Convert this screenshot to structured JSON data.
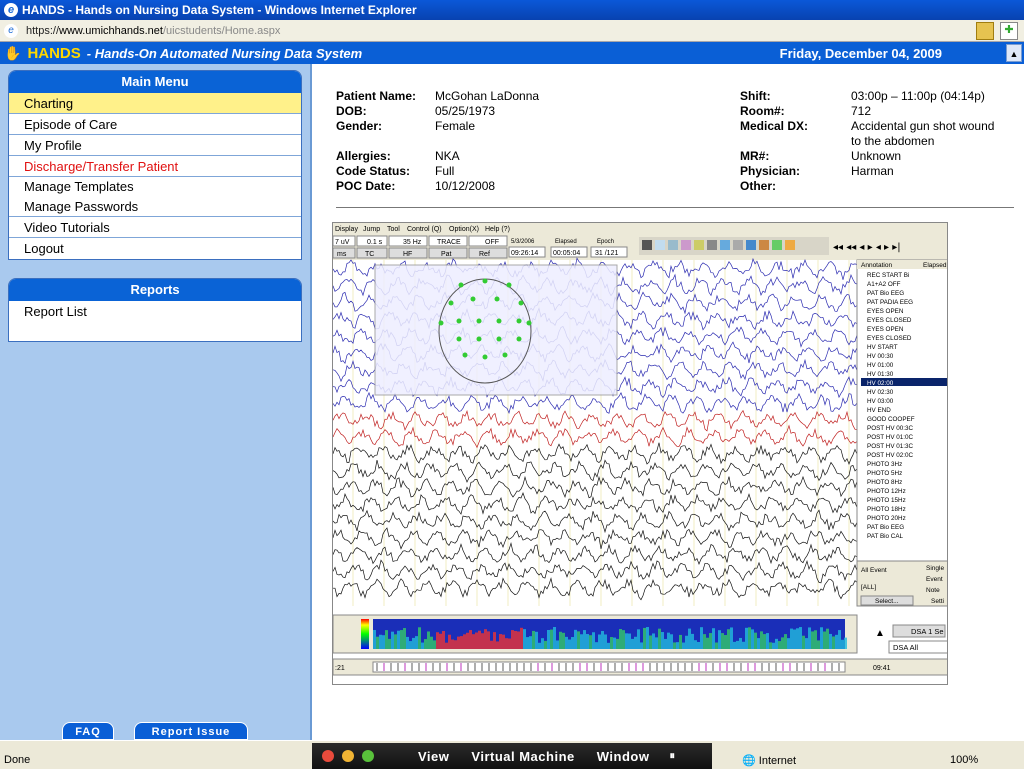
{
  "window": {
    "title": "HANDS - Hands on Nursing Data System - Windows Internet Explorer"
  },
  "address": {
    "scheme": "https://",
    "host": "www.umichhands.net",
    "path": "/uicstudents/Home.aspx"
  },
  "header": {
    "logo": "HANDS",
    "subtitle": "- Hands-On Automated Nursing Data System",
    "date": "Friday, December 04, 2009"
  },
  "main_menu": {
    "title": "Main Menu",
    "items": [
      {
        "label": "Charting"
      },
      {
        "label": "Episode of Care"
      },
      {
        "label": "My Profile"
      },
      {
        "label": "Discharge/Transfer Patient"
      },
      {
        "label": "Manage Templates"
      },
      {
        "label": "Manage Passwords"
      },
      {
        "label": "Video Tutorials"
      },
      {
        "label": "Logout"
      }
    ]
  },
  "reports_menu": {
    "title": "Reports",
    "items": [
      {
        "label": "Report List"
      }
    ]
  },
  "footer_buttons": {
    "faq": "FAQ",
    "report_issue": "Report Issue"
  },
  "patient": {
    "left": [
      {
        "label": "Patient Name:",
        "value": "McGohan LaDonna"
      },
      {
        "label": "DOB:",
        "value": "05/25/1973"
      },
      {
        "label": "Gender:",
        "value": "Female"
      },
      {
        "label": "Allergies:",
        "value": "NKA"
      },
      {
        "label": "Code Status:",
        "value": "Full"
      },
      {
        "label": "POC Date:",
        "value": "10/12/2008"
      }
    ],
    "right": [
      {
        "label": "Shift:",
        "value": "03:00p – 11:00p (04:14p)"
      },
      {
        "label": "Room#:",
        "value": "712"
      },
      {
        "label": "Medical DX:",
        "value": "Accidental gun shot wound",
        "value2": "to the abdomen"
      },
      {
        "label": "MR#:",
        "value": "Unknown"
      },
      {
        "label": "Physician:",
        "value": "Harman"
      },
      {
        "label": "Other:",
        "value": ""
      }
    ]
  },
  "eeg": {
    "menu": [
      "Display",
      "Jump",
      "Tool",
      "Control (Q)",
      "Option(X)",
      "Help (?)"
    ],
    "controls": {
      "gain": "7 uV",
      "time": "0.1 s",
      "hf": "35 Hz",
      "trace": "TRACE",
      "off": "OFF",
      "date": "5/3/2006",
      "clock": "09:26:14",
      "elapsed_label": "Elapsed",
      "elapsed": "00:05:04",
      "epoch_label": "Epoch",
      "epoch": "31 /121"
    },
    "buttons": [
      "ms",
      "TC",
      "HF",
      "Pat",
      "Ref"
    ],
    "annotation_header": [
      "Annotation",
      "Elapsed"
    ],
    "annotations": [
      "REC START Bi",
      "A1+A2 OFF",
      "PAT Bio EEG",
      "PAT PADIA EEG",
      "EYES OPEN",
      "EYES CLOSED",
      "EYES OPEN",
      "EYES CLOSED",
      "HV START",
      "HV 00:30",
      "HV 01:00",
      "HV 01:30",
      "HV 02:00",
      "HV 02:30",
      "HV 03:00",
      "HV END",
      "GOOD COOPEF",
      "POST HV 00:3C",
      "POST HV 01:0C",
      "POST HV 01:3C",
      "POST HV 02:0C",
      "PHOTO 3Hz",
      "PHOTO 5Hz",
      "PHOTO 8Hz",
      "PHOTO 12Hz",
      "PHOTO 15Hz",
      "PHOTO 18Hz",
      "PHOTO 20Hz",
      "PAT Bio EEG",
      "PAT Bio CAL"
    ],
    "event_panel": {
      "all_event": "All Event",
      "all": "[ALL]",
      "single": "Single",
      "event": "Event",
      "note": "Note",
      "select": "Select...",
      "sett": "Setti"
    },
    "dsa": {
      "label": "DSA 1 Se",
      "dsa_all": "DSA All"
    },
    "bottom_time_left": ":21",
    "bottom_time_right": "09:41"
  },
  "taskbar": {
    "status": "Done",
    "vm_menu": [
      "View",
      "Virtual Machine",
      "Window"
    ],
    "zone": "Internet",
    "zoom": "100%"
  }
}
